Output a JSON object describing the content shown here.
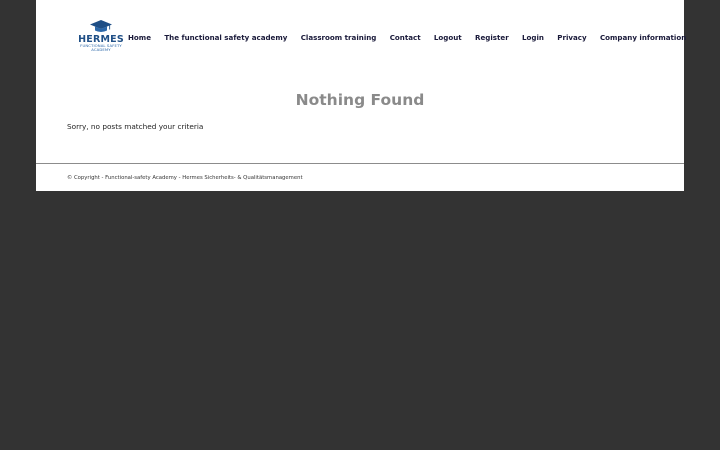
{
  "logo": {
    "icon": "graduation-cap-icon",
    "word": "HERMES",
    "sub_line1": "FUNCTIONAL SAFETY",
    "sub_line2": "ACADEMY",
    "brand_color": "#1f4f86"
  },
  "nav": {
    "items": [
      {
        "label": "Home"
      },
      {
        "label": "The functional safety academy"
      },
      {
        "label": "Classroom training"
      },
      {
        "label": "Contact"
      },
      {
        "label": "Logout"
      },
      {
        "label": "Register"
      },
      {
        "label": "Login"
      },
      {
        "label": "Privacy"
      },
      {
        "label": "Company information"
      }
    ]
  },
  "main": {
    "title": "Nothing Found",
    "message": "Sorry, no posts matched your criteria"
  },
  "footer": {
    "copyright": "© Copyright - Functional-safety Academy - Hermes Sicherheits- & Qualitätsmanagement"
  },
  "colors": {
    "background": "#333333",
    "content": "#ffffff",
    "title": "#8a8a8a"
  }
}
